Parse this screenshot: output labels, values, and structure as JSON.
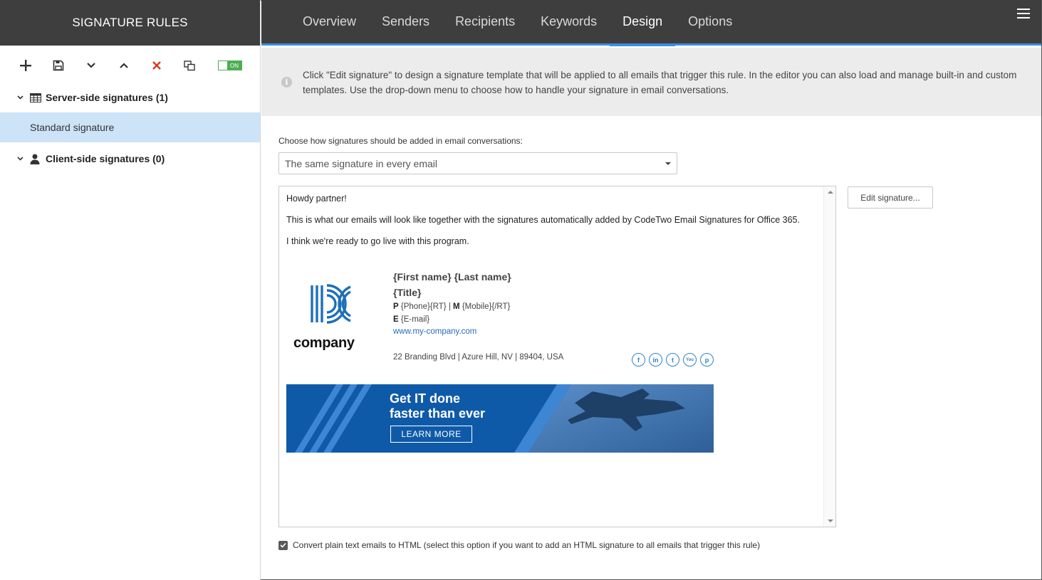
{
  "sidebar": {
    "title": "SIGNATURE RULES",
    "toggle_label": "ON",
    "groups": [
      {
        "label": "Server-side signatures (1)",
        "items": [
          "Standard signature"
        ]
      },
      {
        "label": "Client-side signatures (0)",
        "items": []
      }
    ]
  },
  "tabs": [
    "Overview",
    "Senders",
    "Recipients",
    "Keywords",
    "Design",
    "Options"
  ],
  "active_tab": "Design",
  "info": {
    "text": "Click \"Edit signature\" to design a signature template that will be applied to all emails that trigger this rule. In the editor you can also load and manage built-in and custom templates. Use the drop-down menu to choose how to handle your signature in email conversations."
  },
  "conversation": {
    "label": "Choose how signatures should be added in email conversations:",
    "selected": "The same signature in every email"
  },
  "preview": {
    "greeting": "Howdy partner!",
    "body1": "This is what our emails will look like together with the signatures automatically added by CodeTwo Email Signatures for Office 365.",
    "body2": "I think we're ready to go live with this program.",
    "signature": {
      "logo_word": "company",
      "name": "{First name} {Last name}",
      "title": "{Title}",
      "phone_prefix": "P",
      "phone_value": "{Phone}{RT}",
      "sep": "|",
      "mobile_prefix": "M",
      "mobile_value": "{Mobile}{/RT}",
      "email_prefix": "E",
      "email_value": "{E-mail}",
      "website": "www.my-company.com",
      "address": "22 Branding Blvd | Azure Hill, NV | 89404, USA",
      "socials": [
        {
          "name": "facebook-icon",
          "glyph": "f"
        },
        {
          "name": "linkedin-icon",
          "glyph": "in"
        },
        {
          "name": "twitter-icon",
          "glyph": "t"
        },
        {
          "name": "youtube-icon",
          "glyph": "You"
        },
        {
          "name": "pinterest-icon",
          "glyph": "p"
        }
      ]
    },
    "banner": {
      "line1": "Get IT done",
      "line2": "faster than ever",
      "button": "LEARN MORE"
    }
  },
  "edit_button": "Edit signature...",
  "convert_checkbox": {
    "checked": true,
    "label": "Convert plain text emails to HTML (select this option if you want to add an HTML signature to all emails that trigger this rule)"
  },
  "colors": {
    "header_bg": "#3e3e3e",
    "accent": "#3b8ee0",
    "selected_item": "#cce3f8",
    "delete_red": "#d9381e",
    "toggle_green": "#4caf50"
  }
}
